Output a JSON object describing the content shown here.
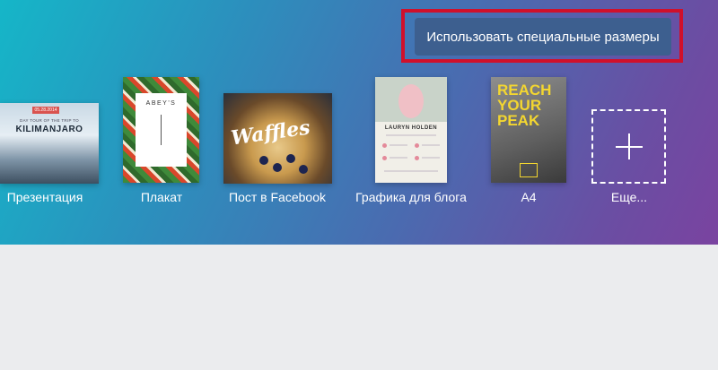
{
  "custom_sizes_button": "Использовать специальные размеры",
  "templates": [
    {
      "label": "Презентация",
      "thumb_date": "05.28.2014",
      "thumb_subtitle": "DAY TOUR OF THE TRIP TO",
      "thumb_title": "KILIMANJARO"
    },
    {
      "label": "Плакат",
      "thumb_title": "ABEY'S"
    },
    {
      "label": "Пост в Facebook",
      "thumb_title": "Waffles"
    },
    {
      "label": "Графика для блога",
      "thumb_title": "LAURYN HOLDEN"
    },
    {
      "label": "A4",
      "thumb_title": "REACH YOUR PEAK"
    },
    {
      "label": "Еще...",
      "icon": "plus-icon"
    }
  ],
  "colors": {
    "highlight": "#d0102b",
    "button": "#3d5f8f"
  }
}
